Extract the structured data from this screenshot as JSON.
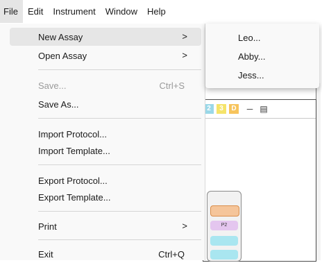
{
  "menubar": {
    "items": [
      "File",
      "Edit",
      "Instrument",
      "Window",
      "Help"
    ]
  },
  "file_menu": {
    "new_assay": "New Assay",
    "open_assay": "Open Assay",
    "save": "Save...",
    "save_shortcut": "Ctrl+S",
    "save_as": "Save As...",
    "import_protocol": "Import Protocol...",
    "import_template": "Import Template...",
    "export_protocol": "Export Protocol...",
    "export_template": "Export Template...",
    "print": "Print",
    "exit": "Exit",
    "exit_shortcut": "Ctrl+Q",
    "submenu_arrow": ">"
  },
  "new_assay_submenu": {
    "items": [
      "Leo...",
      "Abby...",
      "Jess..."
    ]
  },
  "background_window": {
    "chips": [
      "2",
      "3",
      "D"
    ],
    "chip_colors": [
      "#9ad8e8",
      "#f5e46a",
      "#f7c45c"
    ],
    "minimize_icon": "minimize-icon",
    "maximize_icon": "maximize-icon",
    "plate_label": "P2"
  }
}
